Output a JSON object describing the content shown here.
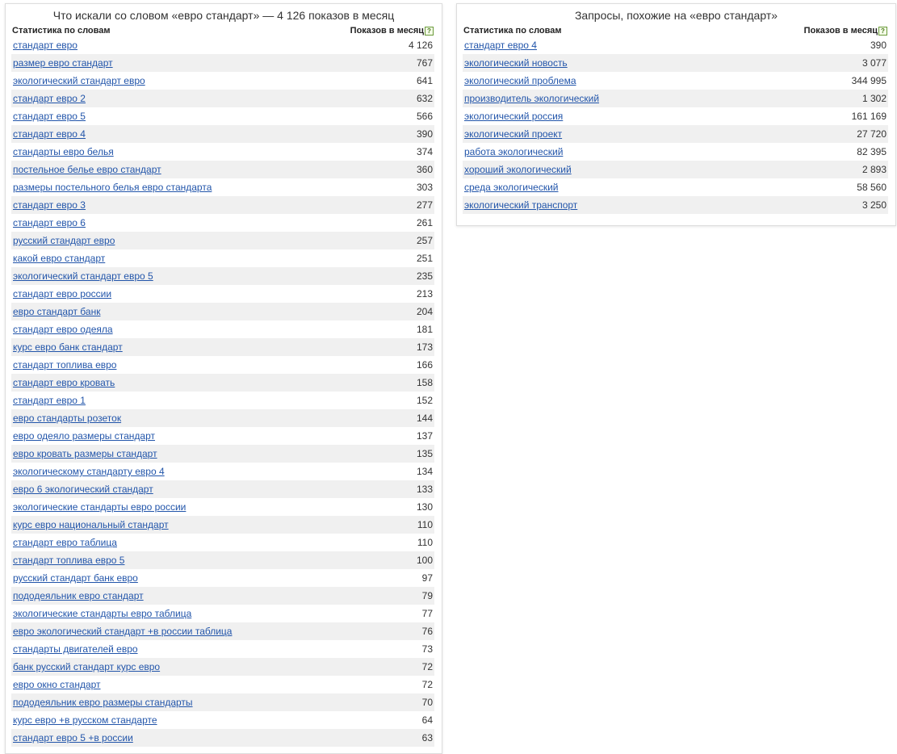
{
  "left": {
    "title": "Что искали со словом «евро стандарт» — 4 126 показов в месяц",
    "col_query": "Статистика по словам",
    "col_count": "Показов в месяц",
    "help_glyph": "?",
    "rows": [
      {
        "q": "стандарт евро",
        "n": "4 126"
      },
      {
        "q": "размер евро стандарт",
        "n": "767"
      },
      {
        "q": "экологический стандарт евро",
        "n": "641"
      },
      {
        "q": "стандарт евро 2",
        "n": "632"
      },
      {
        "q": "стандарт евро 5",
        "n": "566"
      },
      {
        "q": "стандарт евро 4",
        "n": "390"
      },
      {
        "q": "стандарты евро белья",
        "n": "374"
      },
      {
        "q": "постельное белье евро стандарт",
        "n": "360"
      },
      {
        "q": "размеры постельного белья евро стандарта",
        "n": "303"
      },
      {
        "q": "стандарт евро 3",
        "n": "277"
      },
      {
        "q": "стандарт евро 6",
        "n": "261"
      },
      {
        "q": "русский стандарт евро",
        "n": "257"
      },
      {
        "q": "какой евро стандарт",
        "n": "251"
      },
      {
        "q": "экологический стандарт евро 5",
        "n": "235"
      },
      {
        "q": "стандарт евро россии",
        "n": "213"
      },
      {
        "q": "евро стандарт банк",
        "n": "204"
      },
      {
        "q": "стандарт евро одеяла",
        "n": "181"
      },
      {
        "q": "курс евро банк стандарт",
        "n": "173"
      },
      {
        "q": "стандарт топлива евро",
        "n": "166"
      },
      {
        "q": "стандарт евро кровать",
        "n": "158"
      },
      {
        "q": "стандарт евро 1",
        "n": "152"
      },
      {
        "q": "евро стандарты розеток",
        "n": "144"
      },
      {
        "q": "евро одеяло размеры стандарт",
        "n": "137"
      },
      {
        "q": "евро кровать размеры стандарт",
        "n": "135"
      },
      {
        "q": "экологическому стандарту евро 4",
        "n": "134"
      },
      {
        "q": "евро 6 экологический стандарт",
        "n": "133"
      },
      {
        "q": "экологические стандарты евро россии",
        "n": "130"
      },
      {
        "q": "курс евро национальный стандарт",
        "n": "110"
      },
      {
        "q": "стандарт евро таблица",
        "n": "110"
      },
      {
        "q": "стандарт топлива евро 5",
        "n": "100"
      },
      {
        "q": "русский стандарт банк евро",
        "n": "97"
      },
      {
        "q": "пододеяльник евро стандарт",
        "n": "79"
      },
      {
        "q": "экологические стандарты евро таблица",
        "n": "77"
      },
      {
        "q": "евро экологический стандарт +в россии таблица",
        "n": "76"
      },
      {
        "q": "стандарты двигателей евро",
        "n": "73"
      },
      {
        "q": "банк русский стандарт курс евро",
        "n": "72"
      },
      {
        "q": "евро окно стандарт",
        "n": "72"
      },
      {
        "q": "пододеяльник евро размеры стандарты",
        "n": "70"
      },
      {
        "q": "курс евро +в русском стандарте",
        "n": "64"
      },
      {
        "q": "стандарт евро 5 +в россии",
        "n": "63"
      }
    ]
  },
  "right": {
    "title": "Запросы, похожие на «евро стандарт»",
    "col_query": "Статистика по словам",
    "col_count": "Показов в месяц",
    "help_glyph": "?",
    "rows": [
      {
        "q": "стандарт евро 4",
        "n": "390"
      },
      {
        "q": "экологический новость",
        "n": "3 077"
      },
      {
        "q": "экологический проблема",
        "n": "344 995"
      },
      {
        "q": "производитель экологический",
        "n": "1 302"
      },
      {
        "q": "экологический россия",
        "n": "161 169"
      },
      {
        "q": "экологический проект",
        "n": "27 720"
      },
      {
        "q": "работа экологический",
        "n": "82 395"
      },
      {
        "q": "хороший экологический",
        "n": "2 893"
      },
      {
        "q": "среда экологический",
        "n": "58 560"
      },
      {
        "q": "экологический транспорт",
        "n": "3 250"
      }
    ]
  }
}
